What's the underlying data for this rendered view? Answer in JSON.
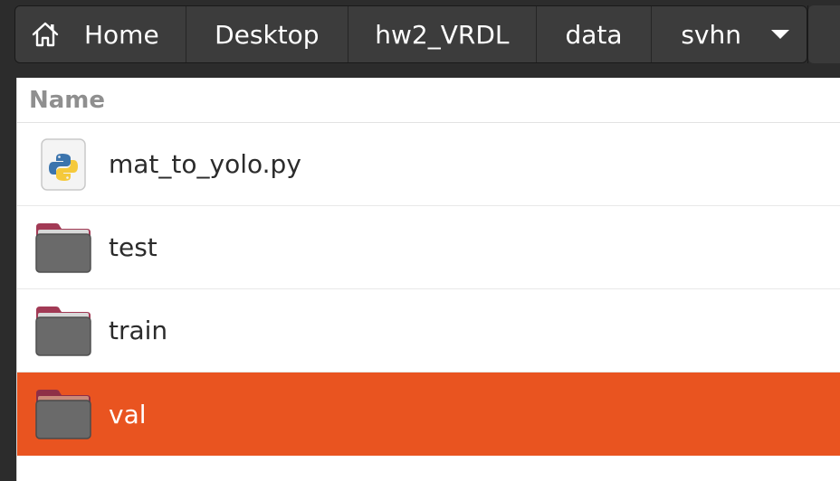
{
  "pathbar": {
    "crumbs": [
      {
        "label": "Home",
        "icon": "home-icon"
      },
      {
        "label": "Desktop"
      },
      {
        "label": "hw2_VRDL"
      },
      {
        "label": "data"
      },
      {
        "label": "svhn",
        "icon": "chevron-down-icon"
      }
    ]
  },
  "list": {
    "column_header": "Name",
    "items": [
      {
        "name": "mat_to_yolo.py",
        "type": "python-file-icon",
        "selected": false
      },
      {
        "name": "test",
        "type": "folder-icon",
        "selected": false
      },
      {
        "name": "train",
        "type": "folder-icon",
        "selected": false
      },
      {
        "name": "val",
        "type": "folder-icon",
        "selected": true
      }
    ]
  },
  "colors": {
    "selection": "#e95420",
    "folder_tab": "#a23a55",
    "folder_body": "#6a6a6a",
    "pathbar_bg": "#3c3c3c",
    "header_text": "#8f8f8f"
  }
}
